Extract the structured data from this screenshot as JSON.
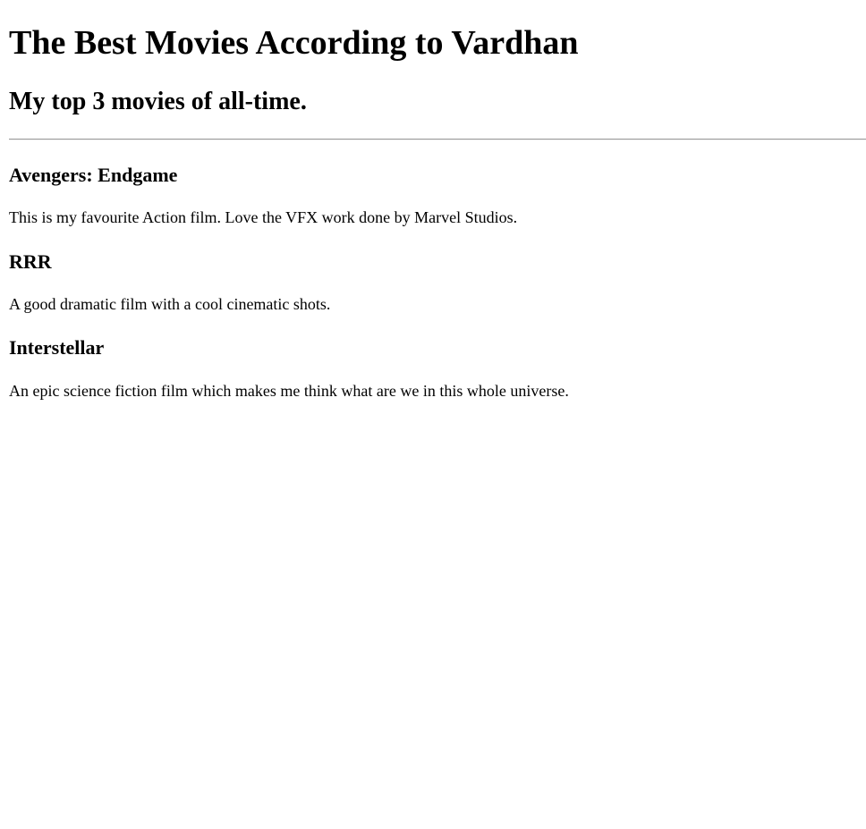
{
  "page": {
    "title": "The Best Movies According to Vardhan",
    "subtitle": "My top 3 movies of all-time."
  },
  "movies": [
    {
      "name": "Avengers: Endgame",
      "description": "This is my favourite Action film. Love the VFX work done by Marvel Studios."
    },
    {
      "name": "RRR",
      "description": "A good dramatic film with a cool cinematic shots."
    },
    {
      "name": "Interstellar",
      "description": "An epic science fiction film which makes me think what are we in this whole universe."
    }
  ]
}
